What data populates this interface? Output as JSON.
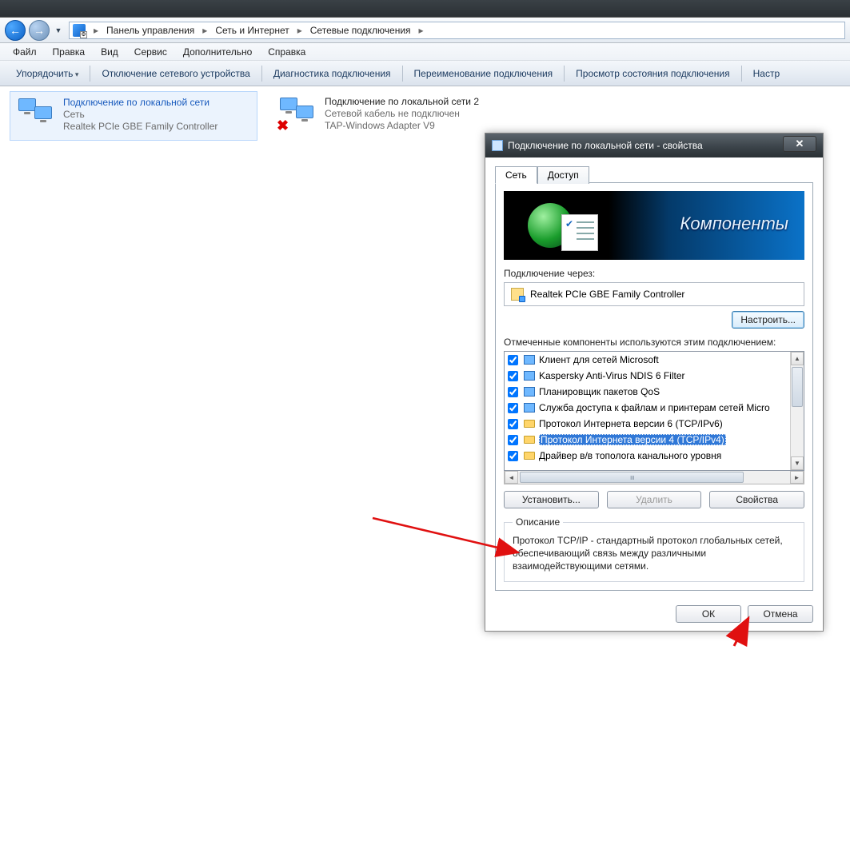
{
  "breadcrumbs": {
    "root_icon": "control-panel-icon",
    "items": [
      "Панель управления",
      "Сеть и Интернет",
      "Сетевые подключения"
    ]
  },
  "menu": {
    "file": "Файл",
    "edit": "Правка",
    "view": "Вид",
    "tools": "Сервис",
    "advanced": "Дополнительно",
    "help": "Справка"
  },
  "commands": {
    "organize": "Упорядочить",
    "disable": "Отключение сетевого устройства",
    "diagnose": "Диагностика подключения",
    "rename": "Переименование подключения",
    "status": "Просмотр состояния подключения",
    "settings": "Настр"
  },
  "connections": [
    {
      "title": "Подключение по локальной сети",
      "status": "Сеть",
      "adapter": "Realtek PCIe GBE Family Controller",
      "disconnected": false
    },
    {
      "title": "Подключение по локальной сети 2",
      "status": "Сетевой кабель не подключен",
      "adapter": "TAP-Windows Adapter V9",
      "disconnected": true
    }
  ],
  "dialog": {
    "title": "Подключение по локальной сети - свойства",
    "tabs": {
      "network": "Сеть",
      "access": "Доступ"
    },
    "banner_text": "Компоненты",
    "connect_using_label": "Подключение через:",
    "adapter": "Realtek PCIe GBE Family Controller",
    "configure_btn": "Настроить...",
    "components_label": "Отмеченные компоненты используются этим подключением:",
    "components": [
      {
        "checked": true,
        "icon": "client",
        "label": "Клиент для сетей Microsoft"
      },
      {
        "checked": true,
        "icon": "filter",
        "label": "Kaspersky Anti-Virus NDIS 6 Filter"
      },
      {
        "checked": true,
        "icon": "qos",
        "label": "Планировщик пакетов QoS"
      },
      {
        "checked": true,
        "icon": "service",
        "label": "Служба доступа к файлам и принтерам сетей Micro"
      },
      {
        "checked": true,
        "icon": "protocol",
        "label": "Протокол Интернета версии 6 (TCP/IPv6)"
      },
      {
        "checked": true,
        "icon": "protocol",
        "label": "Протокол Интернета версии 4 (TCP/IPv4)",
        "selected": true
      },
      {
        "checked": true,
        "icon": "driver",
        "label": "Драйвер в/в тополога канального уровня"
      }
    ],
    "install_btn": "Установить...",
    "uninstall_btn": "Удалить",
    "properties_btn": "Свойства",
    "description_legend": "Описание",
    "description_text": "Протокол TCP/IP - стандартный протокол глобальных сетей, обеспечивающий связь между различными взаимодействующими сетями.",
    "ok_btn": "ОК",
    "cancel_btn": "Отмена"
  }
}
